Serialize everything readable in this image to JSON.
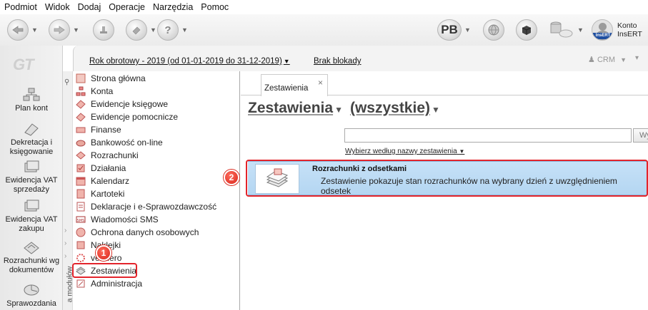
{
  "menu": [
    "Podmiot",
    "Widok",
    "Dodaj",
    "Operacje",
    "Narzędzia",
    "Pomoc"
  ],
  "toolbar": {
    "pb_label": "PB",
    "account_line1": "Konto",
    "account_line2": "InsERT",
    "avatar_text": "InsERT"
  },
  "leftbar": {
    "logo": "GT",
    "items": [
      "Plan kont",
      "Dekretacja i księgowanie",
      "Ewidencja VAT sprzedaży",
      "Ewidencja VAT zakupu",
      "Rozrachunki wg dokumentów",
      "Sprawozdania"
    ]
  },
  "infobar": {
    "year": "Rok obrotowy - 2019  (od 01-01-2019 do 31-12-2019)",
    "lock": "Brak blokady",
    "crm": "CRM"
  },
  "modules": {
    "strip_label": "a modułów",
    "items": [
      "Strona główna",
      "Konta",
      "Ewidencje księgowe",
      "Ewidencje pomocnicze",
      "Finanse",
      "Bankowość on-line",
      "Rozrachunki",
      "Działania",
      "Kalendarz",
      "Kartoteki",
      "Deklaracje i e-Sprawozdawczość",
      "Wiadomości SMS",
      "Ochrona danych osobowych",
      "Naklejki",
      "vendero",
      "Zestawienia",
      "Administracja"
    ],
    "selected": "Zestawienia"
  },
  "callouts": {
    "one": "1",
    "two": "2"
  },
  "main": {
    "tab_label": "Zestawienia",
    "tab_close": "×",
    "heading_primary": "Zestawienia",
    "heading_secondary": "(wszystkie)",
    "search_value": "",
    "search_button": "Wy",
    "filter_label": "Wybierz według nazwy zestawienia",
    "rows": [
      {
        "title": "Rozrachunki z odsetkami",
        "description": "Zestawienie pokazuje stan rozrachunków na wybrany dzień z uwzględnieniem odsetek"
      }
    ]
  },
  "colors": {
    "accent_red": "#e3242b",
    "row_blue": "#c6e1f7"
  }
}
